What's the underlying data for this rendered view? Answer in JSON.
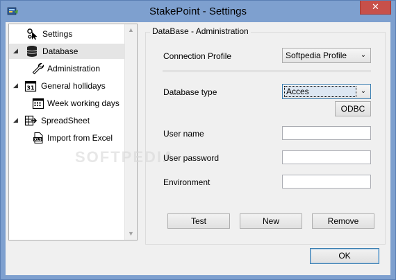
{
  "window": {
    "title": "StakePoint - Settings",
    "close_glyph": "✕"
  },
  "tree": {
    "items": [
      {
        "label": "Settings",
        "icon": "settings-cursor-icon",
        "level": 0
      },
      {
        "label": "Database",
        "icon": "database-icon",
        "level": 0,
        "selected": true,
        "expanded": true
      },
      {
        "label": "Administration",
        "icon": "wrench-icon",
        "level": 1
      },
      {
        "label": "General hollidays",
        "icon": "calendar-31-icon",
        "level": 0,
        "expanded": true
      },
      {
        "label": "Week working days",
        "icon": "calendar-grid-icon",
        "level": 1
      },
      {
        "label": "SpreadSheet",
        "icon": "spreadsheet-export-icon",
        "level": 0,
        "expanded": true
      },
      {
        "label": "Import from Excel",
        "icon": "xls-file-icon",
        "level": 1
      }
    ],
    "xls_badge": "XLS",
    "calendar_number": "31"
  },
  "group": {
    "title": "DataBase - Administration",
    "connection_profile_label": "Connection Profile",
    "connection_profile_value": "Softpedia Profile",
    "database_type_label": "Database type",
    "database_type_value": "Acces",
    "odbc_label": "ODBC",
    "user_name_label": "User name",
    "user_password_label": "User password",
    "environment_label": "Environment",
    "user_name_value": "",
    "user_password_value": "",
    "environment_value": ""
  },
  "actions": {
    "test": "Test",
    "new": "New",
    "remove": "Remove",
    "ok": "OK"
  },
  "watermark": "SOFTPEDIA",
  "colors": {
    "titlebar": "#7ea0cf",
    "close": "#c7504a",
    "selection": "#e5e5e5",
    "focus": "#3c7fb1"
  }
}
